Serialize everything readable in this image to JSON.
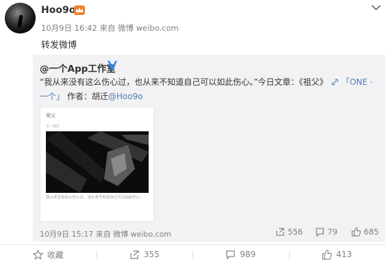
{
  "post": {
    "username": "Hoo9o",
    "meta": "10月9日 16:42 来自 微博 weibo.com",
    "text": "转发微博"
  },
  "quoted": {
    "author": "@一个App工作室",
    "text_open": "“我从来没有这么伤心过，也从来不知道自己可以如此伤心。”今日文章：《祖父》",
    "link_text": "「ONE ·",
    "line2_link": "一个」",
    "line2_mid": " 作者：胡迁",
    "mention": "@Hoo9o",
    "card": {
      "title": "祖父",
      "sub": "文 / 胡迁",
      "caption": "我从来没有这么伤心过，也从来不知道自己可以如此伤心。"
    },
    "time": "10月9日 15:17 来自 微博 weibo.com",
    "reposts": "556",
    "comments": "79",
    "likes": "685"
  },
  "actions": {
    "favorite": "收藏",
    "repost": "355",
    "comment": "989",
    "like": "413"
  },
  "icons": [
    "user-avatar",
    "vip-crown-icon",
    "chevron-down-icon",
    "verified-v-icon",
    "link-icon",
    "repost-icon",
    "comment-icon",
    "like-icon",
    "star-icon"
  ],
  "colors": {
    "accent": "#eb7350",
    "link": "#507daf",
    "quote_bg": "#f2f2f5"
  }
}
